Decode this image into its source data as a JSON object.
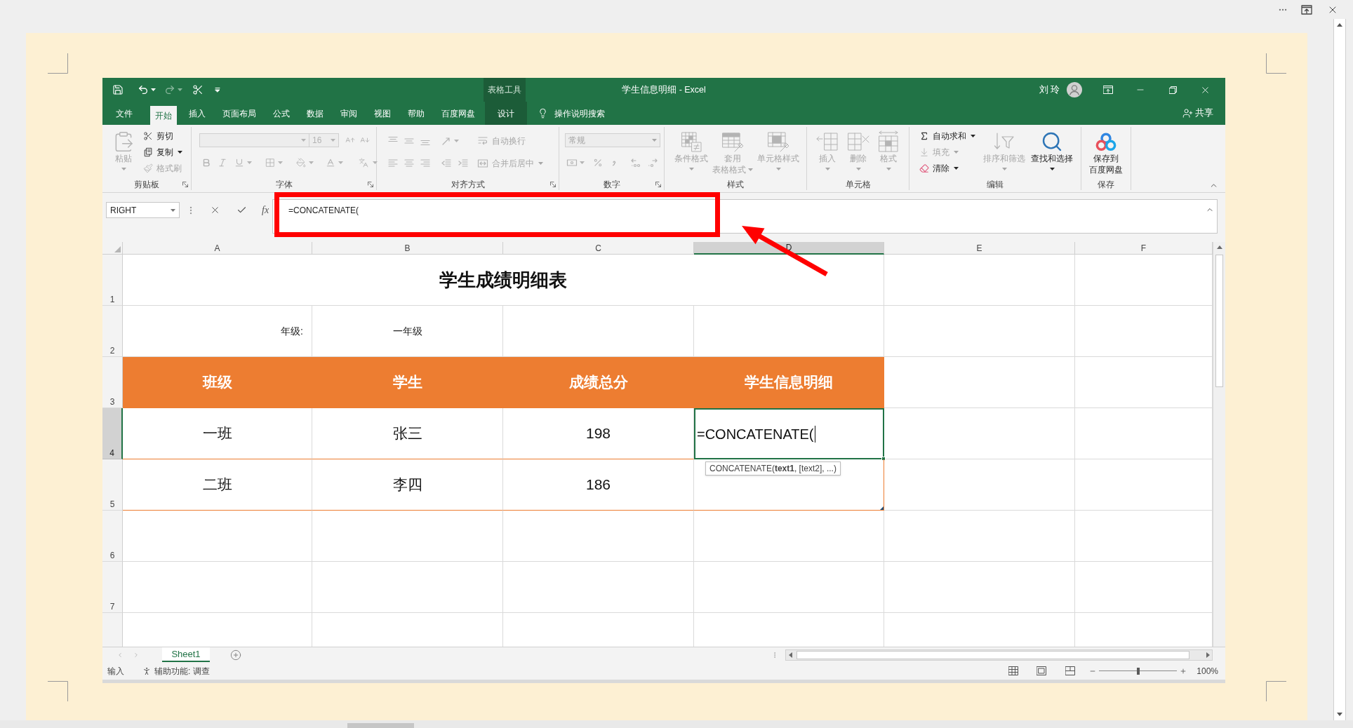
{
  "title_bar": {
    "contextual_group": "表格工具",
    "title": "学生信息明细 - Excel",
    "user_name": "刘 玲"
  },
  "ribbon_tabs": [
    {
      "label": "文件",
      "selected": false,
      "kind": "file"
    },
    {
      "label": "开始",
      "selected": true,
      "kind": "tab"
    },
    {
      "label": "插入",
      "selected": false,
      "kind": "tab"
    },
    {
      "label": "页面布局",
      "selected": false,
      "kind": "tab"
    },
    {
      "label": "公式",
      "selected": false,
      "kind": "tab"
    },
    {
      "label": "数据",
      "selected": false,
      "kind": "tab"
    },
    {
      "label": "审阅",
      "selected": false,
      "kind": "tab"
    },
    {
      "label": "视图",
      "selected": false,
      "kind": "tab"
    },
    {
      "label": "帮助",
      "selected": false,
      "kind": "tab"
    },
    {
      "label": "百度网盘",
      "selected": false,
      "kind": "tab"
    },
    {
      "label": "设计",
      "selected": false,
      "kind": "contextual"
    }
  ],
  "tell_me": {
    "placeholder": "操作说明搜索"
  },
  "share": "共享",
  "ribbon_groups": [
    {
      "kind": "clipboard",
      "label": "剪贴板",
      "dialog_launcher": true,
      "large": [
        {
          "lines": [
            "粘贴"
          ],
          "disabled": true,
          "dropdown": true
        }
      ],
      "small": [
        {
          "label": "剪切",
          "disabled": false,
          "dropdown": false
        },
        {
          "label": "复制",
          "disabled": false,
          "dropdown": true
        },
        {
          "label": "格式刷",
          "disabled": true,
          "dropdown": false
        }
      ]
    },
    {
      "kind": "font",
      "label": "字体",
      "dialog_launcher": true,
      "disabled": true,
      "font_size": "16"
    },
    {
      "kind": "alignment",
      "label": "对齐方式",
      "dialog_launcher": true,
      "disabled": true,
      "small": [
        {
          "label": "自动换行",
          "dropdown": false
        },
        {
          "label": "合并后居中",
          "dropdown": true
        }
      ]
    },
    {
      "kind": "number",
      "label": "数字",
      "dialog_launcher": true,
      "disabled": true,
      "format": "常规"
    },
    {
      "kind": "styles",
      "label": "样式",
      "dialog_launcher": false,
      "large": [
        {
          "lines": [
            "条件格式"
          ],
          "disabled": true,
          "dropdown": true
        },
        {
          "lines": [
            "套用",
            "表格格式"
          ],
          "disabled": true,
          "dropdown": true
        },
        {
          "lines": [
            "单元格样式"
          ],
          "disabled": true,
          "dropdown": true
        }
      ]
    },
    {
      "kind": "cells",
      "label": "单元格",
      "dialog_launcher": false,
      "large": [
        {
          "lines": [
            "插入"
          ],
          "disabled": true,
          "dropdown": true
        },
        {
          "lines": [
            "删除"
          ],
          "disabled": true,
          "dropdown": true
        },
        {
          "lines": [
            "格式"
          ],
          "disabled": true,
          "dropdown": true
        }
      ]
    },
    {
      "kind": "editing",
      "label": "编辑",
      "dialog_launcher": false,
      "small": [
        {
          "label": "自动求和",
          "disabled": false,
          "dropdown": true
        },
        {
          "label": "填充",
          "disabled": true,
          "dropdown": true
        },
        {
          "label": "清除",
          "disabled": false,
          "dropdown": true
        }
      ],
      "large": [
        {
          "lines": [
            "排序和筛选"
          ],
          "disabled": true,
          "dropdown": true
        },
        {
          "lines": [
            "查找和选择"
          ],
          "disabled": false,
          "dropdown": true
        }
      ]
    },
    {
      "kind": "save",
      "label": "保存",
      "dialog_launcher": false,
      "large": [
        {
          "lines": [
            "保存到",
            "百度网盘"
          ],
          "disabled": false,
          "dropdown": false
        }
      ]
    }
  ],
  "formula_bar": {
    "name_box": "RIGHT",
    "function_button": "fx",
    "formula": "=CONCATENATE("
  },
  "sheet": {
    "columns": [
      {
        "label": "A",
        "selected": false
      },
      {
        "label": "B",
        "selected": false
      },
      {
        "label": "C",
        "selected": false
      },
      {
        "label": "D",
        "selected": true
      },
      {
        "label": "E",
        "selected": false
      },
      {
        "label": "F",
        "selected": false
      }
    ],
    "rows": [
      {
        "label": "1",
        "selected": false,
        "kind": "title",
        "title": "学生成绩明细表"
      },
      {
        "label": "2",
        "selected": false,
        "kind": "field",
        "field_label": "年级:",
        "field_value": "一年级"
      },
      {
        "label": "3",
        "selected": false,
        "kind": "header",
        "cells": [
          "班级",
          "学生",
          "成绩总分",
          "学生信息明细"
        ]
      },
      {
        "label": "4",
        "selected": true,
        "kind": "data",
        "cells": [
          "一班",
          "张三",
          "198"
        ],
        "editing": {
          "value": "=CONCATENATE(",
          "hint": "CONCATENATE(**text1**, [text2], ...)"
        }
      },
      {
        "label": "5",
        "selected": false,
        "kind": "data",
        "cells": [
          "二班",
          "李四",
          "186"
        ]
      },
      {
        "label": "6",
        "selected": false,
        "kind": "empty"
      },
      {
        "label": "7",
        "selected": false,
        "kind": "empty"
      }
    ]
  },
  "sheet_tabs": [
    {
      "label": "Sheet1",
      "selected": true
    }
  ],
  "status_bar": {
    "mode": "输入",
    "accessibility": "辅助功能: 调查",
    "zoom": {
      "level": 0.5,
      "reading": "100%"
    }
  }
}
